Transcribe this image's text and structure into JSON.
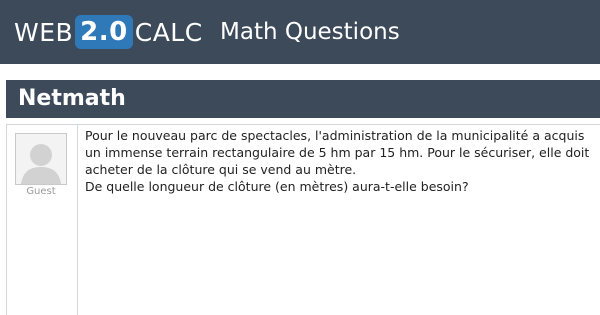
{
  "header": {
    "logo_left": "WEB",
    "logo_badge": "2.0",
    "logo_right": "CALC",
    "site_title": "Math Questions",
    "background_color": "#3c4a5a",
    "badge_color": "#2f79b9"
  },
  "page_title": "Netmath",
  "post": {
    "author": "Guest",
    "avatar_icon": "default-user-icon",
    "lines": [
      "Pour le nouveau parc de spectacles, l'administration de la municipalité a acquis",
      "un immense terrain rectangulaire de 5 hm par 15 hm. Pour le sécuriser, elle doit",
      "acheter de la clôture qui se vend au mètre.",
      "De quelle longueur de clôture (en mètres) aura-t-elle besoin?"
    ]
  }
}
